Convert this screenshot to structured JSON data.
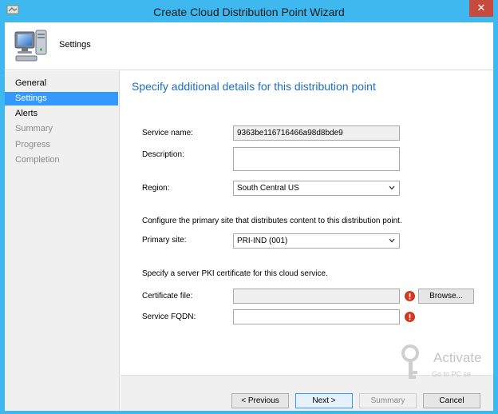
{
  "window": {
    "title": "Create Cloud Distribution Point Wizard",
    "close_glyph": "✕"
  },
  "header": {
    "title": "Settings",
    "icon": "computer-icon"
  },
  "nav": {
    "items": [
      {
        "label": "General",
        "state": "done"
      },
      {
        "label": "Settings",
        "state": "active"
      },
      {
        "label": "Alerts",
        "state": "done"
      },
      {
        "label": "Summary",
        "state": "pending"
      },
      {
        "label": "Progress",
        "state": "pending"
      },
      {
        "label": "Completion",
        "state": "pending"
      }
    ]
  },
  "page": {
    "heading": "Specify additional details for this distribution point",
    "service_name_label": "Service name:",
    "service_name_value": "9363be116716466a98d8bde9",
    "description_label": "Description:",
    "description_value": "",
    "region_label": "Region:",
    "region_value": "South Central US",
    "primary_site_intro": "Configure the primary site that distributes content to this distribution point.",
    "primary_site_label": "Primary site:",
    "primary_site_value": "PRI-IND (001)",
    "certificate_intro": "Specify a server PKI certificate for this cloud service.",
    "certificate_label": "Certificate file:",
    "certificate_value": "",
    "browse_label": "Browse...",
    "fqdn_label": "Service FQDN:",
    "fqdn_value": ""
  },
  "footer": {
    "previous_label": "< Previous",
    "next_label": "Next >",
    "summary_label": "Summary",
    "cancel_label": "Cancel"
  },
  "watermark": {
    "title": "Activate",
    "subtitle": "Go to PC se"
  },
  "colors": {
    "titlebar": "#3fb8f0",
    "heading": "#1c6dc4",
    "selection": "#3399ff",
    "error": "#d9381e"
  }
}
